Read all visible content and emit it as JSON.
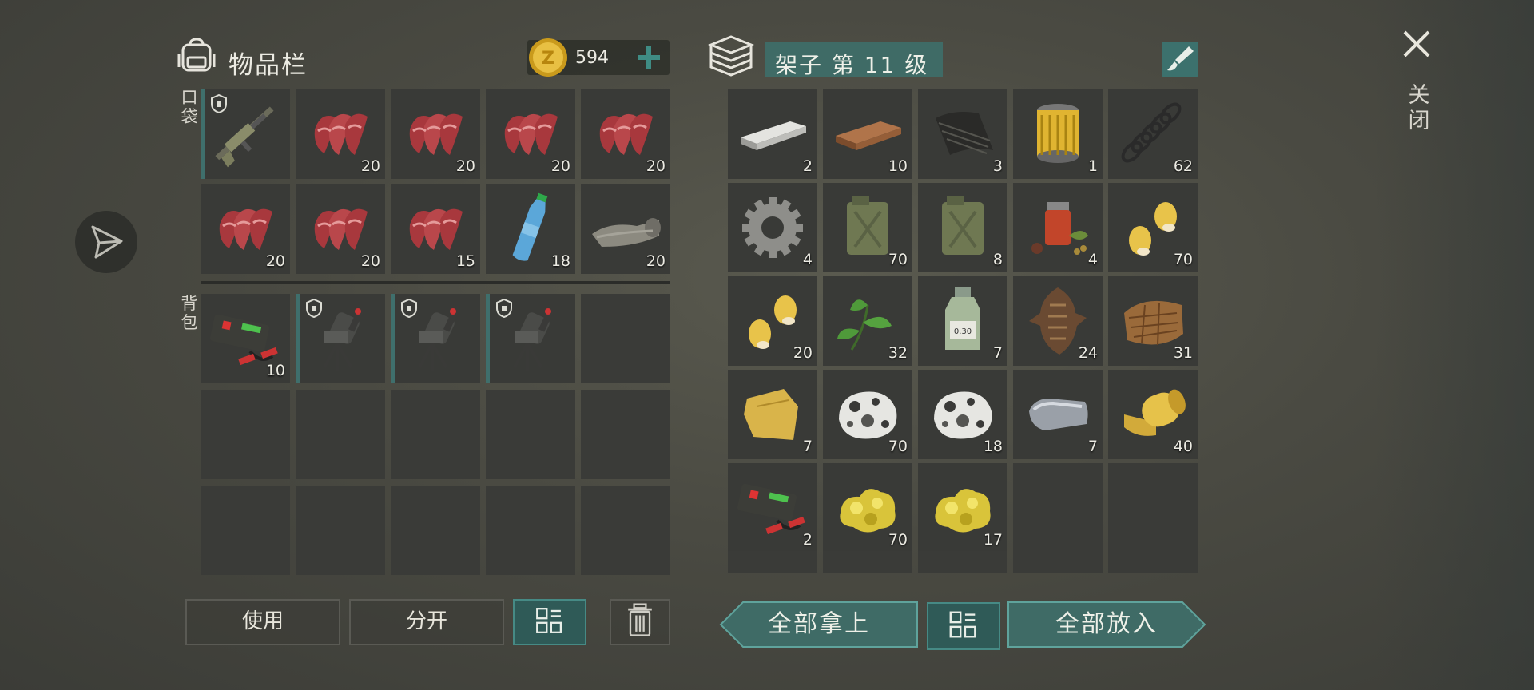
{
  "header": {
    "inventory_title": "物品栏",
    "coins": "594",
    "shelf_title": "架子 第 11 级"
  },
  "close_label": "关闭",
  "sections": {
    "pocket": "口袋",
    "backpack": "背包"
  },
  "pocket_slots": [
    {
      "icon": "rifle-icon",
      "count": "",
      "locked": true
    },
    {
      "icon": "raw-meat-icon",
      "count": "20"
    },
    {
      "icon": "raw-meat-icon",
      "count": "20"
    },
    {
      "icon": "raw-meat-icon",
      "count": "20"
    },
    {
      "icon": "raw-meat-icon",
      "count": "20"
    },
    {
      "icon": "raw-meat-icon",
      "count": "20"
    },
    {
      "icon": "raw-meat-icon",
      "count": "20"
    },
    {
      "icon": "raw-meat-icon",
      "count": "15"
    },
    {
      "icon": "water-bottle-icon",
      "count": "18"
    },
    {
      "icon": "cloth-roll-icon",
      "count": "20"
    }
  ],
  "backpack_slots": [
    {
      "icon": "car-battery-icon",
      "count": "10"
    },
    {
      "icon": "mounted-turret-icon",
      "count": "",
      "locked": true
    },
    {
      "icon": "mounted-turret-icon",
      "count": "",
      "locked": true
    },
    {
      "icon": "mounted-turret-icon",
      "count": "",
      "locked": true
    },
    {
      "icon": "",
      "count": ""
    },
    {
      "icon": "",
      "count": ""
    },
    {
      "icon": "",
      "count": ""
    },
    {
      "icon": "",
      "count": ""
    },
    {
      "icon": "",
      "count": ""
    },
    {
      "icon": "",
      "count": ""
    },
    {
      "icon": "",
      "count": ""
    },
    {
      "icon": "",
      "count": ""
    },
    {
      "icon": "",
      "count": ""
    },
    {
      "icon": "",
      "count": ""
    },
    {
      "icon": "",
      "count": ""
    }
  ],
  "shelf_slots": [
    {
      "icon": "metal-bar-icon",
      "count": "2"
    },
    {
      "icon": "wood-plank-icon",
      "count": "10"
    },
    {
      "icon": "carbon-sheet-icon",
      "count": "3"
    },
    {
      "icon": "oil-filter-icon",
      "count": "1"
    },
    {
      "icon": "spring-icon",
      "count": "62"
    },
    {
      "icon": "gear-icon",
      "count": "4"
    },
    {
      "icon": "jerry-can-icon",
      "count": "70"
    },
    {
      "icon": "jerry-can-icon",
      "count": "8"
    },
    {
      "icon": "spices-icon",
      "count": "4"
    },
    {
      "icon": "corn-icon",
      "count": "70"
    },
    {
      "icon": "corn-icon",
      "count": "20"
    },
    {
      "icon": "leaves-icon",
      "count": "32"
    },
    {
      "icon": "chemical-bottle-icon",
      "count": "7"
    },
    {
      "icon": "reptile-skin-icon",
      "count": "24"
    },
    {
      "icon": "snake-leather-icon",
      "count": "31"
    },
    {
      "icon": "yellow-cloth-icon",
      "count": "7"
    },
    {
      "icon": "ore-rock-icon",
      "count": "70"
    },
    {
      "icon": "ore-rock-icon",
      "count": "18"
    },
    {
      "icon": "iron-ingot-icon",
      "count": "7"
    },
    {
      "icon": "yellow-fabric-roll-icon",
      "count": "40"
    },
    {
      "icon": "car-battery-icon",
      "count": "2"
    },
    {
      "icon": "gold-nugget-icon",
      "count": "70"
    },
    {
      "icon": "gold-nugget-icon",
      "count": "17"
    },
    {
      "icon": "",
      "count": ""
    },
    {
      "icon": "",
      "count": ""
    }
  ],
  "buttons": {
    "use": "使用",
    "split": "分开",
    "take_all": "全部拿上",
    "put_all": "全部放入"
  },
  "colors": {
    "accent": "#3f6b66",
    "slot": "#393a37",
    "meat": "#b4484b",
    "gold": "#d9b23a"
  }
}
